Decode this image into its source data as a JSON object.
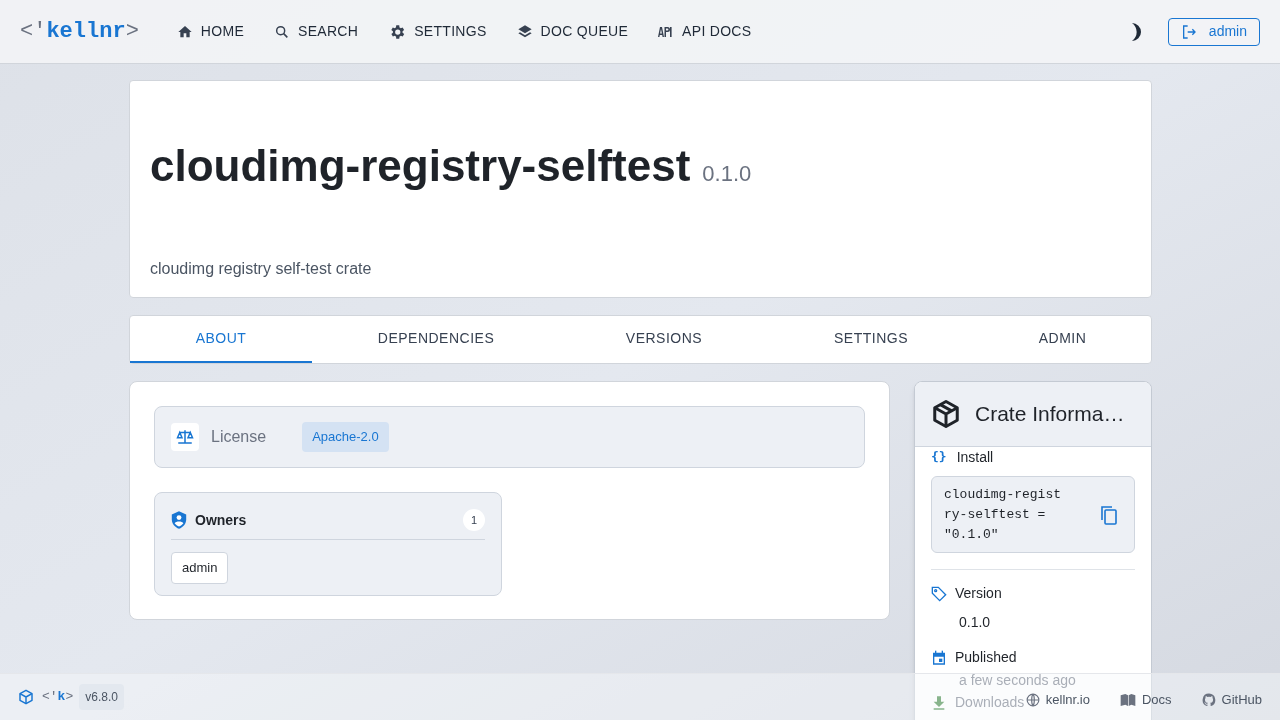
{
  "brand": {
    "prefix": "<'",
    "name": "kellnr",
    "suffix": ">"
  },
  "nav": [
    {
      "label": "HOME"
    },
    {
      "label": "SEARCH"
    },
    {
      "label": "SETTINGS"
    },
    {
      "label": "DOC QUEUE"
    },
    {
      "label": "API DOCS"
    }
  ],
  "user_button": "admin",
  "crate": {
    "name": "cloudimg-registry-selftest",
    "version": "0.1.0",
    "description": "cloudimg registry self-test crate"
  },
  "tabs": [
    {
      "label": "ABOUT",
      "selected": true
    },
    {
      "label": "DEPENDENCIES",
      "selected": false
    },
    {
      "label": "VERSIONS",
      "selected": false
    },
    {
      "label": "SETTINGS",
      "selected": false
    },
    {
      "label": "ADMIN",
      "selected": false
    }
  ],
  "license": {
    "label": "License",
    "value": "Apache-2.0"
  },
  "owners": {
    "title": "Owners",
    "count": "1",
    "items": [
      "admin"
    ]
  },
  "crate_info": {
    "title": "Crate Informa…",
    "install_glyph": "{}",
    "install_label": "Install",
    "install_snippet": "cloudimg-registry-selftest = \"0.1.0\"",
    "version_label": "Version",
    "version": "0.1.0",
    "published_label": "Published",
    "published": "a few seconds ago",
    "downloads_label": "Downloads"
  },
  "footer": {
    "logo": "<'k>",
    "version": "v6.8.0",
    "links": [
      {
        "label": "kellnr.io"
      },
      {
        "label": "Docs"
      },
      {
        "label": "GitHub"
      }
    ]
  }
}
